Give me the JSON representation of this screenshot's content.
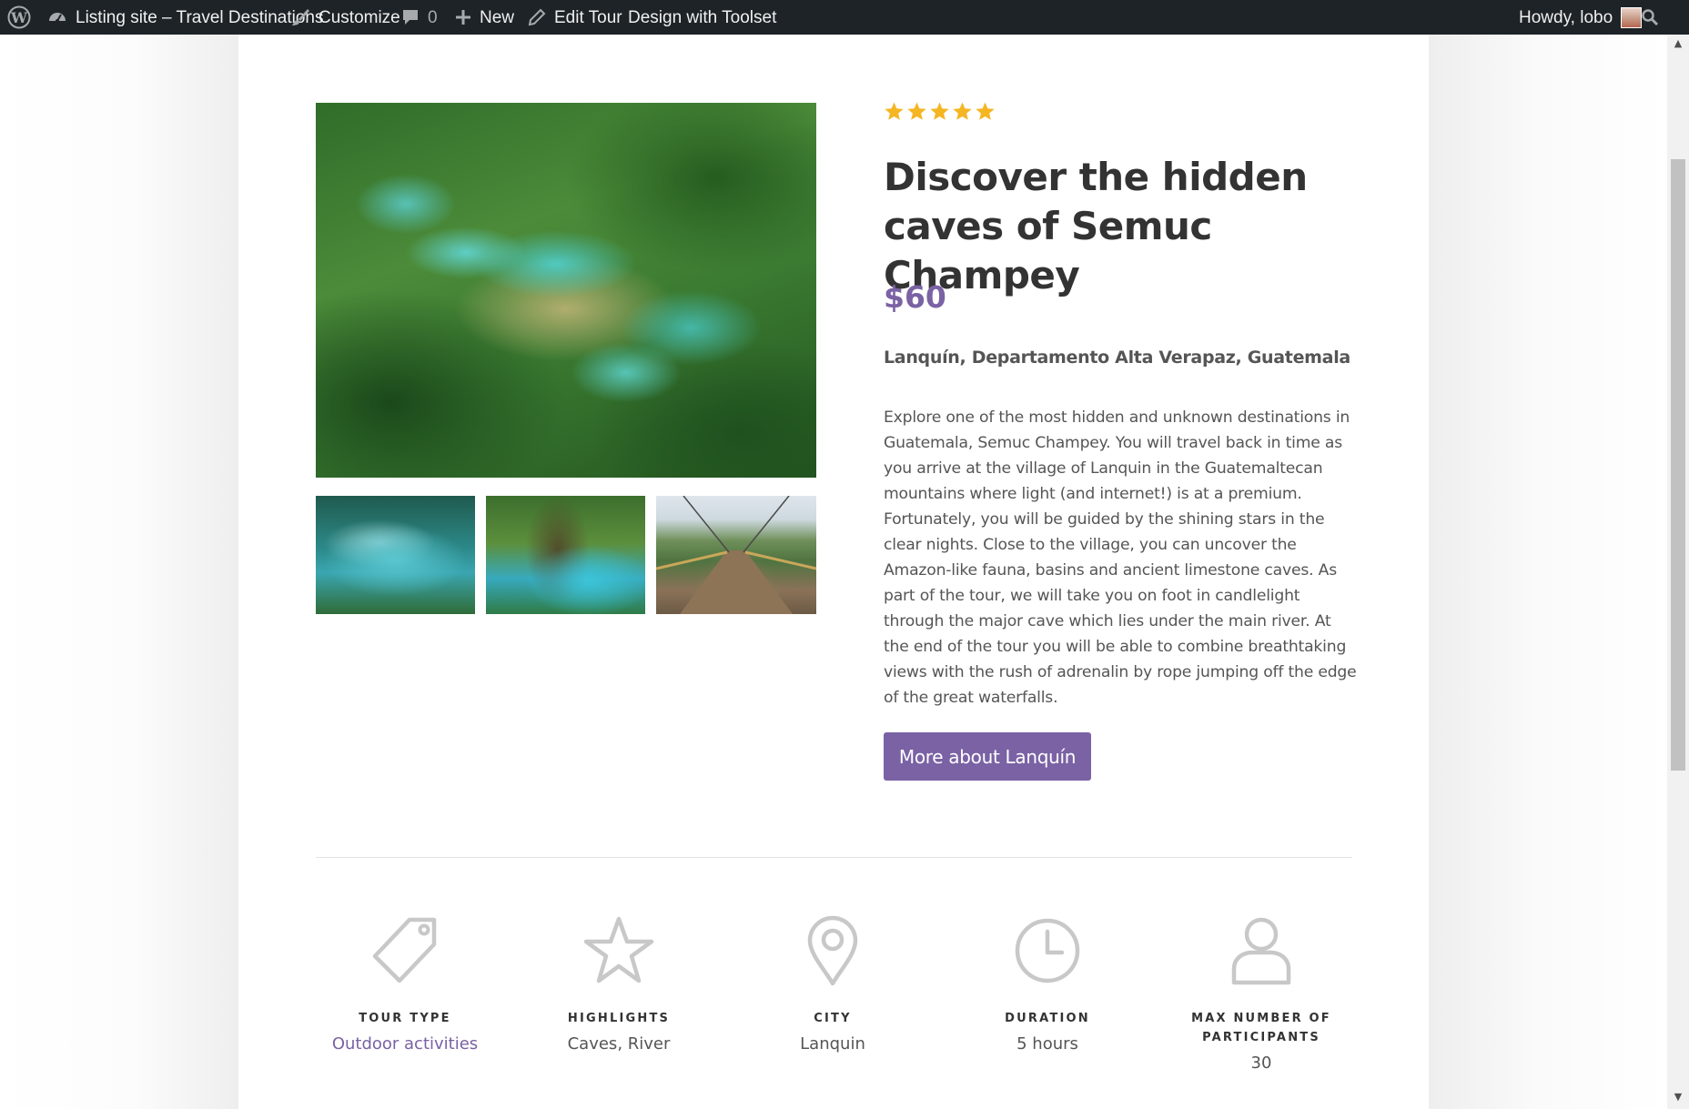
{
  "admin_bar": {
    "site_name": "Listing site – Travel Destinations",
    "customize": "Customize",
    "comments_count": "0",
    "new": "New",
    "edit": "Edit Tour",
    "toolset": "Design with Toolset",
    "howdy": "Howdy, lobo"
  },
  "tour": {
    "rating": 5,
    "title": "Discover the hidden caves of Semuc Champey",
    "price": "$60",
    "location": "Lanquín, Departamento Alta Verapaz, Guatemala",
    "description": "Explore one of the most hidden and unknown destinations in Guatemala, Semuc Champey. You will travel back in time as you arrive at the village of Lanquin in the Guatemaltecan mountains where light (and internet!) is at a premium. Fortunately, you will be guided by the shining stars in the clear nights. Close to the village, you can uncover the Amazon-like fauna, basins and ancient limestone caves. As part of the tour, we will take you on foot in candlelight through the major cave which lies under the main river. At the end of the tour you will be able to combine breathtaking views with the rush of adrenalin by rope jumping off the edge of the great waterfalls.",
    "more_button": "More about Lanquín"
  },
  "features": [
    {
      "icon": "tag-icon",
      "label": "TOUR TYPE",
      "value": "Outdoor activities"
    },
    {
      "icon": "star-outline-icon",
      "label": "HIGHLIGHTS",
      "value": "Caves, River"
    },
    {
      "icon": "map-pin-icon",
      "label": "CITY",
      "value": "Lanquin"
    },
    {
      "icon": "clock-icon",
      "label": "DURATION",
      "value": "5 hours"
    },
    {
      "icon": "person-icon",
      "label": "MAX NUMBER OF PARTICIPANTS",
      "value": "30"
    }
  ],
  "colors": {
    "accent": "#7a62a4",
    "star": "#f5b623",
    "admin_bar": "#1d2327",
    "icon_outline": "#c8c8c8"
  }
}
